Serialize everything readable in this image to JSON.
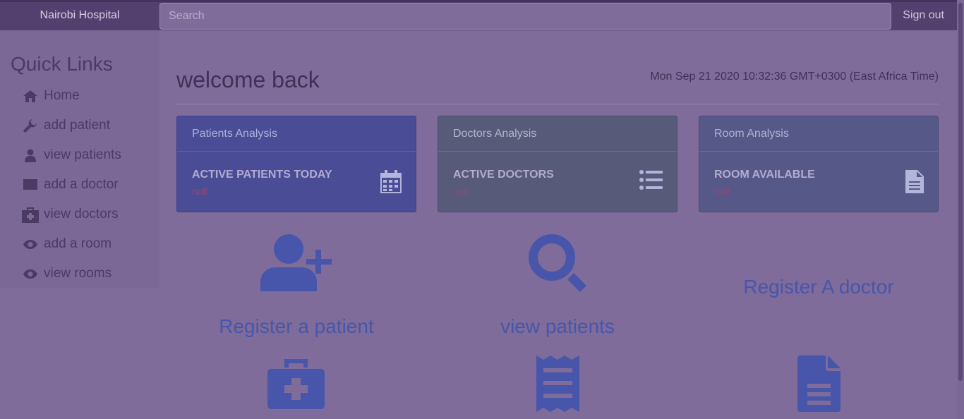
{
  "header": {
    "brand": "Nairobi Hospital",
    "search_placeholder": "Search",
    "signout_label": "Sign out"
  },
  "sidebar": {
    "title": "Quick Links",
    "items": [
      {
        "label": "Home",
        "icon": "home-icon"
      },
      {
        "label": "add patient",
        "icon": "wrench-icon"
      },
      {
        "label": "view patients",
        "icon": "user-icon"
      },
      {
        "label": "add a doctor",
        "icon": "envelope-icon"
      },
      {
        "label": "view doctors",
        "icon": "medkit-icon"
      },
      {
        "label": "add a room",
        "icon": "eye-icon"
      },
      {
        "label": "view rooms",
        "icon": "eye-icon"
      }
    ]
  },
  "main": {
    "title": "welcome back",
    "datetime": "Mon Sep 21 2020 10:32:36 GMT+0300 (East Africa Time)",
    "cards": [
      {
        "heading": "Patients Analysis",
        "label": "ACTIVE PATIENTS TODAY",
        "value": "null",
        "icon": "calendar-icon"
      },
      {
        "heading": "Doctors Analysis",
        "label": "ACTIVE DOCTORS",
        "value": "null",
        "icon": "list-icon"
      },
      {
        "heading": "Room Analysis",
        "label": "ROOM AVAILABLE",
        "value": "null",
        "icon": "file-text-icon"
      }
    ],
    "actions": [
      {
        "label": "Register a patient",
        "icon": "user-plus-icon"
      },
      {
        "label": "view patients",
        "icon": "search-icon"
      },
      {
        "label": "Register A doctor",
        "icon": ""
      }
    ],
    "bottom_icons": [
      "medkit-icon",
      "receipt-icon",
      "file-text-icon"
    ]
  },
  "colors": {
    "overlay": "#7f6c9a",
    "topbar": "#54406f",
    "accent_link": "#4756aa",
    "card_patients": "#4a4c96",
    "card_doctors": "#585a7a",
    "card_rooms": "#565888"
  }
}
